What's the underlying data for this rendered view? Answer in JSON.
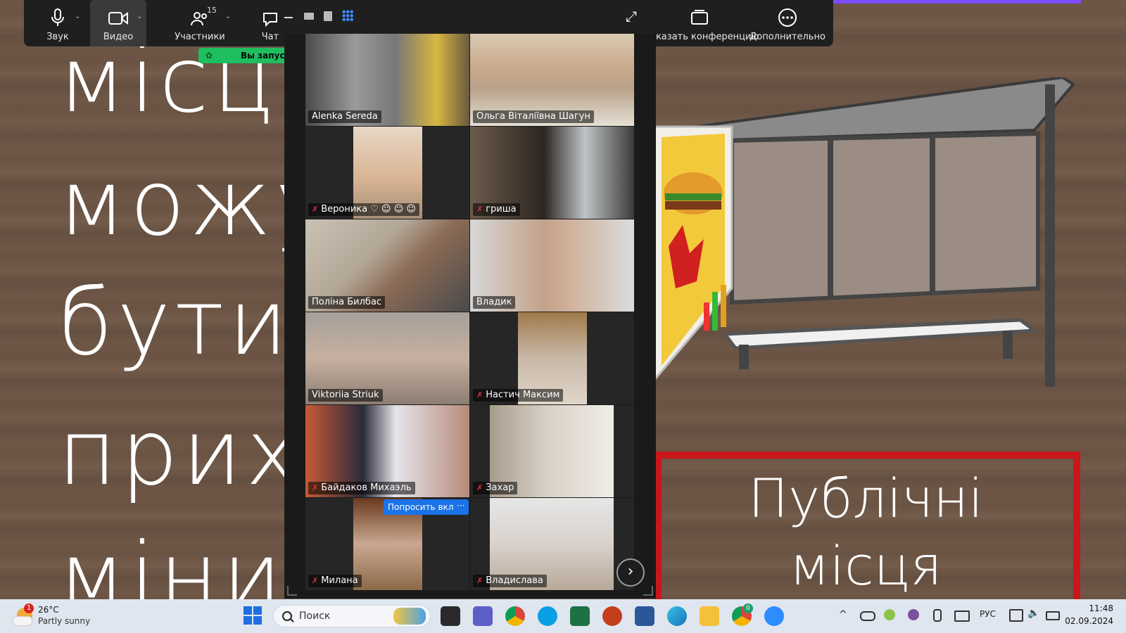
{
  "slide": {
    "left_words": [
      "місц",
      "можу",
      "бути",
      "прих",
      "міни"
    ],
    "right_title_line1": "Публічні",
    "right_title_line2": "місця"
  },
  "toolbar": {
    "audio_label": "Звук",
    "video_label": "Видео",
    "participants_label": "Участники",
    "participants_count": "15",
    "chat_label": "Чат",
    "share_label": "оказать конференцию",
    "more_label": "Дополнительно"
  },
  "recording_banner": "Вы запуст",
  "gallery": {
    "tiles": [
      {
        "name": "Alenka Sereda",
        "muted": false
      },
      {
        "name": "Ольга Віталіївна Шагун",
        "muted": false
      },
      {
        "name": "Вероника",
        "muted": true,
        "emoji": "♡ ☺ ☺ ☺"
      },
      {
        "name": "гриша",
        "muted": true
      },
      {
        "name": "Поліна Билбас",
        "muted": false,
        "active": true
      },
      {
        "name": "Владик",
        "muted": false
      },
      {
        "name": "Viktoriia Striuk",
        "muted": false
      },
      {
        "name": "Настич Максим",
        "muted": true
      },
      {
        "name": "Байдаков Михаэль",
        "muted": true
      },
      {
        "name": "Захар",
        "muted": true
      },
      {
        "name": "Милана",
        "muted": true
      },
      {
        "name": "Владислава",
        "muted": true
      }
    ],
    "ask_unmute_label": "Попросить вкл",
    "more_dots": "···",
    "next_label": "›"
  },
  "taskbar": {
    "weather_temp": "26°C",
    "weather_desc": "Partly sunny",
    "weather_badge": "1",
    "search_placeholder": "Поиск",
    "language": "РУС",
    "time": "11:48",
    "date": "02.09.2024",
    "chrome_badge": "0"
  },
  "colors": {
    "active_speaker": "#2bd16b",
    "ask_button": "#1a73e8",
    "publicni_frame": "#c8161c"
  }
}
